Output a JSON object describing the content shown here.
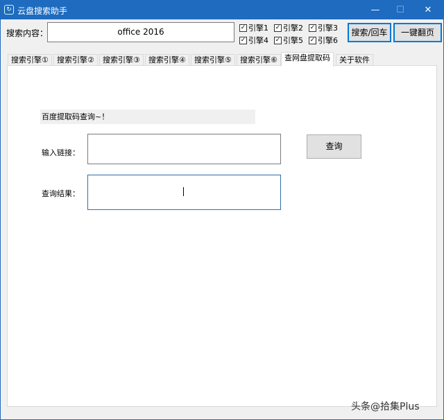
{
  "window": {
    "title": "云盘搜索助手",
    "minimize": "—",
    "maximize": "☐",
    "close": "✕"
  },
  "search": {
    "label": "搜索内容：",
    "value": "office 2016"
  },
  "engines": [
    {
      "label": "引擎1",
      "checked": true
    },
    {
      "label": "引擎2",
      "checked": true
    },
    {
      "label": "引擎3",
      "checked": true
    },
    {
      "label": "引擎4",
      "checked": true
    },
    {
      "label": "引擎5",
      "checked": true
    },
    {
      "label": "引擎6",
      "checked": true
    }
  ],
  "buttons": {
    "search": "搜索/回车",
    "flip": "一键翻页"
  },
  "tabs": [
    "搜索引擎①",
    "搜索引擎②",
    "搜索引擎③",
    "搜索引擎④",
    "搜索引擎⑤",
    "搜索引擎⑥",
    "查网盘提取码",
    "关于软件"
  ],
  "active_tab": 6,
  "panel": {
    "heading": "百度提取码查询~！",
    "link_label": "输入链接：",
    "link_value": "",
    "query_button": "查询",
    "result_label": "查询结果：",
    "result_value": ""
  },
  "watermark": "头条@拾集Plus"
}
